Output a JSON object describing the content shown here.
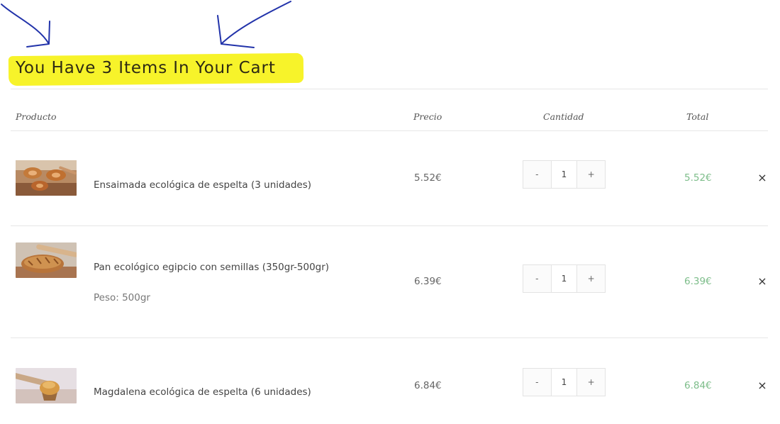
{
  "cart": {
    "title": "You Have 3 Items In Your Cart",
    "highlight_color": "#f7f32a",
    "annotation_color": "#2233aa"
  },
  "table": {
    "headers": {
      "product": "Producto",
      "price": "Precio",
      "quantity": "Cantidad",
      "total": "Total"
    },
    "items": [
      {
        "name": "Ensaimada ecológica de espelta (3 unidades)",
        "meta": "",
        "price": "5.52€",
        "quantity": "1",
        "total": "5.52€",
        "thumb_icon": "ensaimada-photo"
      },
      {
        "name": "Pan ecológico egipcio con semillas (350gr-500gr)",
        "meta": "Peso: 500gr",
        "price": "6.39€",
        "quantity": "1",
        "total": "6.39€",
        "thumb_icon": "bread-loaf-photo"
      },
      {
        "name": "Magdalena ecológica de espelta (6 unidades)",
        "meta": "",
        "price": "6.84€",
        "quantity": "1",
        "total": "6.84€",
        "thumb_icon": "muffin-photo"
      }
    ],
    "controls": {
      "minus": "-",
      "plus": "+",
      "remove": "×"
    }
  },
  "colors": {
    "total_text": "#7dbd8a",
    "rule": "#e6e6e6"
  }
}
